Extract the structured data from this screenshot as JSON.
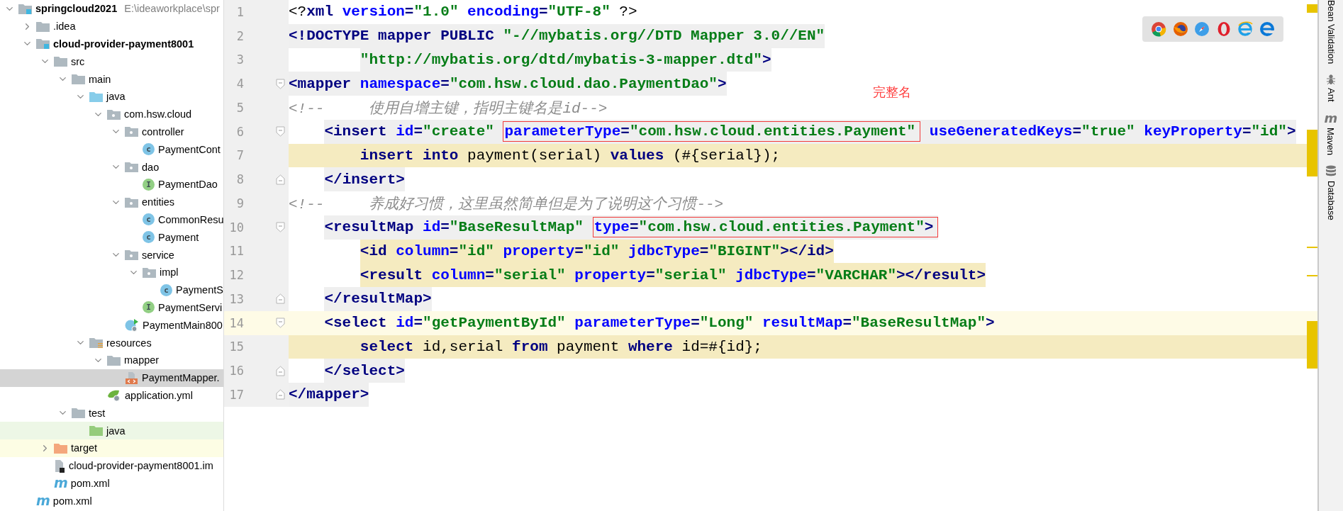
{
  "project_tree": {
    "items": [
      {
        "label": "springcloud2021",
        "path": "E:\\ideaworkplace\\spr",
        "kind": "module",
        "expanded": true,
        "selected": false,
        "children": [
          {
            "label": ".idea",
            "kind": "folder",
            "expanded": false,
            "selected": false
          },
          {
            "label": "cloud-provider-payment8001",
            "kind": "module",
            "expanded": true,
            "selected": false,
            "children": [
              {
                "label": "src",
                "kind": "folder",
                "expanded": true,
                "selected": false,
                "children": [
                  {
                    "label": "main",
                    "kind": "folder",
                    "expanded": true,
                    "selected": false,
                    "children": [
                      {
                        "label": "java",
                        "kind": "source-folder",
                        "expanded": true,
                        "selected": false,
                        "children": [
                          {
                            "label": "com.hsw.cloud",
                            "kind": "package",
                            "expanded": true,
                            "selected": false,
                            "children": [
                              {
                                "label": "controller",
                                "kind": "package",
                                "expanded": true,
                                "selected": false,
                                "children": [
                                  {
                                    "label": "PaymentCont",
                                    "kind": "class",
                                    "glyph": "c",
                                    "selected": false
                                  }
                                ]
                              },
                              {
                                "label": "dao",
                                "kind": "package",
                                "expanded": true,
                                "selected": false,
                                "children": [
                                  {
                                    "label": "PaymentDao",
                                    "kind": "interface",
                                    "glyph": "I",
                                    "selected": false
                                  }
                                ]
                              },
                              {
                                "label": "entities",
                                "kind": "package",
                                "expanded": true,
                                "selected": false,
                                "children": [
                                  {
                                    "label": "CommonResu",
                                    "kind": "class",
                                    "glyph": "c",
                                    "selected": false
                                  },
                                  {
                                    "label": "Payment",
                                    "kind": "class",
                                    "glyph": "c",
                                    "selected": false
                                  }
                                ]
                              },
                              {
                                "label": "service",
                                "kind": "package",
                                "expanded": true,
                                "selected": false,
                                "children": [
                                  {
                                    "label": "impl",
                                    "kind": "package",
                                    "expanded": true,
                                    "selected": false,
                                    "children": [
                                      {
                                        "label": "PaymentS",
                                        "kind": "class",
                                        "glyph": "c",
                                        "selected": false
                                      }
                                    ]
                                  },
                                  {
                                    "label": "PaymentServi",
                                    "kind": "interface",
                                    "glyph": "I",
                                    "selected": false
                                  }
                                ]
                              },
                              {
                                "label": "PaymentMain800",
                                "kind": "boot-class",
                                "selected": false
                              }
                            ]
                          }
                        ]
                      },
                      {
                        "label": "resources",
                        "kind": "resource-folder",
                        "expanded": true,
                        "selected": false,
                        "children": [
                          {
                            "label": "mapper",
                            "kind": "folder",
                            "expanded": true,
                            "selected": false,
                            "children": [
                              {
                                "label": "PaymentMapper.",
                                "kind": "xml",
                                "selected": true
                              }
                            ]
                          },
                          {
                            "label": "application.yml",
                            "kind": "spring-config",
                            "selected": false
                          }
                        ]
                      }
                    ]
                  },
                  {
                    "label": "test",
                    "kind": "folder",
                    "expanded": true,
                    "selected": false,
                    "children": [
                      {
                        "label": "java",
                        "kind": "test-folder",
                        "selected": false
                      }
                    ]
                  }
                ]
              },
              {
                "label": "target",
                "kind": "excluded-folder",
                "expanded": false,
                "selected": false
              },
              {
                "label": "cloud-provider-payment8001.im",
                "kind": "iml",
                "selected": false
              },
              {
                "label": "pom.xml",
                "kind": "maven",
                "glyph": "m",
                "selected": false
              }
            ]
          },
          {
            "label": "pom.xml",
            "kind": "maven",
            "glyph": "m",
            "selected": false
          }
        ]
      }
    ]
  },
  "editor": {
    "lines": [
      {
        "number": "1",
        "kind": "plain",
        "tokens": [
          {
            "kind": "plain",
            "text": "<?"
          },
          {
            "kind": "tag",
            "text": "xml"
          },
          {
            "kind": "attr",
            "text": " version"
          },
          {
            "kind": "punct",
            "text": "="
          },
          {
            "kind": "value",
            "text": "\"1.0\""
          },
          {
            "kind": "attr",
            "text": " encoding"
          },
          {
            "kind": "punct",
            "text": "="
          },
          {
            "kind": "value",
            "text": "\"UTF-8\""
          },
          {
            "kind": "plain",
            "text": " ?>"
          }
        ]
      },
      {
        "number": "2",
        "kind": "tag",
        "tokens": [
          {
            "kind": "punct",
            "text": "<!"
          },
          {
            "kind": "tag",
            "text": "DOCTYPE"
          },
          {
            "kind": "tag",
            "text": " mapper"
          },
          {
            "kind": "tag",
            "text": " PUBLIC"
          },
          {
            "kind": "value",
            "text": " \"-//mybatis.org//DTD Mapper 3.0//EN\""
          }
        ]
      },
      {
        "number": "3",
        "kind": "tag",
        "tokens": [
          {
            "kind": "value",
            "text": "        \"http://mybatis.org/dtd/mybatis-3-mapper.dtd\""
          },
          {
            "kind": "punct",
            "text": ">"
          }
        ]
      },
      {
        "number": "4",
        "kind": "tag",
        "fold_open": true,
        "tokens": [
          {
            "kind": "punct",
            "text": "<"
          },
          {
            "kind": "tag",
            "text": "mapper"
          },
          {
            "kind": "attr",
            "text": " namespace"
          },
          {
            "kind": "punct",
            "text": "="
          },
          {
            "kind": "value",
            "text": "\"com.hsw.cloud.dao.PaymentDao\""
          },
          {
            "kind": "punct",
            "text": ">"
          }
        ]
      },
      {
        "number": "5",
        "kind": "plain",
        "tokens": [
          {
            "kind": "comment",
            "text": "<!--     使用自增主键，指明主键名是id-->"
          }
        ]
      },
      {
        "number": "6",
        "kind": "tag",
        "fold_open": true,
        "tokens": [
          {
            "kind": "punct",
            "text": "    <"
          },
          {
            "kind": "tag",
            "text": "insert"
          },
          {
            "kind": "attr",
            "text": " id"
          },
          {
            "kind": "punct",
            "text": "="
          },
          {
            "kind": "value",
            "text": "\"create\" "
          },
          {
            "kind": "box",
            "tokens": [
              {
                "kind": "attr",
                "text": "parameterType"
              },
              {
                "kind": "punct",
                "text": "="
              },
              {
                "kind": "value",
                "text": "\"com.hsw.cloud.entities.Payment\""
              }
            ]
          },
          {
            "kind": "attr",
            "text": " useGeneratedKeys"
          },
          {
            "kind": "punct",
            "text": "="
          },
          {
            "kind": "value",
            "text": "\"true\""
          },
          {
            "kind": "attr",
            "text": " keyProperty"
          },
          {
            "kind": "punct",
            "text": "="
          },
          {
            "kind": "value",
            "text": "\"id\""
          },
          {
            "kind": "punct",
            "text": ">"
          }
        ]
      },
      {
        "number": "7",
        "kind": "injected",
        "tokens": [
          {
            "kind": "keyword",
            "text": "        insert"
          },
          {
            "kind": "keyword",
            "text": " into"
          },
          {
            "kind": "plain",
            "text": " payment(serial)"
          },
          {
            "kind": "keyword",
            "text": " values"
          },
          {
            "kind": "plain",
            "text": " (#{serial});"
          }
        ]
      },
      {
        "number": "8",
        "kind": "tag",
        "fold_close": true,
        "tokens": [
          {
            "kind": "punct",
            "text": "    </"
          },
          {
            "kind": "tag",
            "text": "insert"
          },
          {
            "kind": "punct",
            "text": ">"
          }
        ]
      },
      {
        "number": "9",
        "kind": "plain",
        "tokens": [
          {
            "kind": "comment",
            "text": "<!--     养成好习惯，这里虽然简单但是为了说明这个习惯-->"
          }
        ]
      },
      {
        "number": "10",
        "kind": "tag",
        "fold_open": true,
        "tokens": [
          {
            "kind": "punct",
            "text": "    <"
          },
          {
            "kind": "tag",
            "text": "resultMap"
          },
          {
            "kind": "attr",
            "text": " id"
          },
          {
            "kind": "punct",
            "text": "="
          },
          {
            "kind": "value",
            "text": "\"BaseResultMap\" "
          },
          {
            "kind": "box",
            "tokens": [
              {
                "kind": "attr",
                "text": "type"
              },
              {
                "kind": "punct",
                "text": "="
              },
              {
                "kind": "value",
                "text": "\"com.hsw.cloud.entities.Payment\""
              },
              {
                "kind": "punct",
                "text": ">"
              }
            ]
          }
        ]
      },
      {
        "number": "11",
        "kind": "injected-text",
        "tokens": [
          {
            "kind": "punct",
            "text": "        <"
          },
          {
            "kind": "tag",
            "text": "id"
          },
          {
            "kind": "attr",
            "text": " column"
          },
          {
            "kind": "punct",
            "text": "="
          },
          {
            "kind": "value",
            "text": "\"id\""
          },
          {
            "kind": "attr",
            "text": " property"
          },
          {
            "kind": "punct",
            "text": "="
          },
          {
            "kind": "value",
            "text": "\"id\""
          },
          {
            "kind": "attr",
            "text": " jdbcType"
          },
          {
            "kind": "punct",
            "text": "="
          },
          {
            "kind": "value",
            "text": "\"BIGINT\""
          },
          {
            "kind": "punct",
            "text": "></"
          },
          {
            "kind": "tag",
            "text": "id"
          },
          {
            "kind": "punct",
            "text": ">"
          }
        ]
      },
      {
        "number": "12",
        "kind": "injected-text",
        "tokens": [
          {
            "kind": "punct",
            "text": "        <"
          },
          {
            "kind": "tag",
            "text": "result"
          },
          {
            "kind": "attr",
            "text": " column"
          },
          {
            "kind": "punct",
            "text": "="
          },
          {
            "kind": "value",
            "text": "\"serial\""
          },
          {
            "kind": "attr",
            "text": " property"
          },
          {
            "kind": "punct",
            "text": "="
          },
          {
            "kind": "value",
            "text": "\"serial\""
          },
          {
            "kind": "attr",
            "text": " jdbcType"
          },
          {
            "kind": "punct",
            "text": "="
          },
          {
            "kind": "value",
            "text": "\"VARCHAR\""
          },
          {
            "kind": "punct",
            "text": "></"
          },
          {
            "kind": "tag",
            "text": "result"
          },
          {
            "kind": "punct",
            "text": ">"
          }
        ]
      },
      {
        "number": "13",
        "kind": "tag",
        "fold_close": true,
        "tokens": [
          {
            "kind": "punct",
            "text": "    </"
          },
          {
            "kind": "tag",
            "text": "resultMap"
          },
          {
            "kind": "punct",
            "text": ">"
          }
        ]
      },
      {
        "number": "14",
        "kind": "caret",
        "fold_open": true,
        "tokens": [
          {
            "kind": "punct",
            "text": "    <"
          },
          {
            "kind": "tag",
            "text": "select"
          },
          {
            "kind": "attr",
            "text": " id"
          },
          {
            "kind": "punct",
            "text": "="
          },
          {
            "kind": "value",
            "text": "\"getPaymentById\""
          },
          {
            "kind": "attr",
            "text": " parameterType"
          },
          {
            "kind": "punct",
            "text": "="
          },
          {
            "kind": "value",
            "text": "\"Long\""
          },
          {
            "kind": "attr",
            "text": " resultMap"
          },
          {
            "kind": "punct",
            "text": "="
          },
          {
            "kind": "value",
            "text": "\"BaseResultMap\""
          },
          {
            "kind": "punct",
            "text": ">"
          }
        ]
      },
      {
        "number": "15",
        "kind": "injected",
        "tokens": [
          {
            "kind": "keyword",
            "text": "        select"
          },
          {
            "kind": "plain",
            "text": " id,serial"
          },
          {
            "kind": "keyword",
            "text": " from"
          },
          {
            "kind": "plain",
            "text": " payment"
          },
          {
            "kind": "keyword",
            "text": " where"
          },
          {
            "kind": "plain",
            "text": " id=#{id};"
          }
        ]
      },
      {
        "number": "16",
        "kind": "tag",
        "fold_close": true,
        "tokens": [
          {
            "kind": "punct",
            "text": "    </"
          },
          {
            "kind": "tag",
            "text": "select"
          },
          {
            "kind": "punct",
            "text": ">"
          }
        ]
      },
      {
        "number": "17",
        "kind": "tag",
        "fold_close": true,
        "tokens": [
          {
            "kind": "punct",
            "text": "</"
          },
          {
            "kind": "tag",
            "text": "mapper"
          },
          {
            "kind": "punct",
            "text": ">"
          }
        ]
      }
    ],
    "annotation": "完整名"
  },
  "tool_strip": [
    {
      "label": "Bean Validation"
    },
    {
      "label": "Ant",
      "kind": "ant"
    },
    {
      "label": "Maven",
      "kind": "maven",
      "glyph": "m"
    },
    {
      "label": "Database",
      "kind": "database"
    }
  ]
}
